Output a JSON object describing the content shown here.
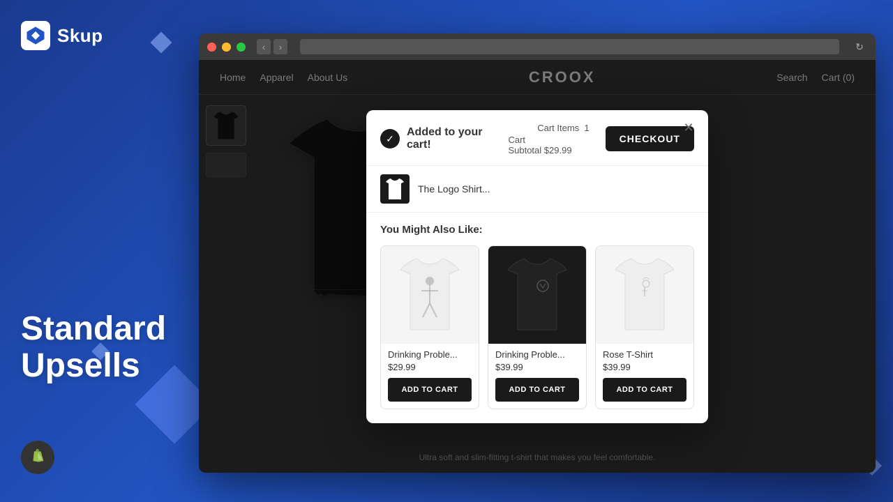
{
  "app": {
    "name": "Skup",
    "tagline": "Standard\nUpsells"
  },
  "browser": {
    "url": ""
  },
  "website": {
    "nav": {
      "home": "Home",
      "apparel": "Apparel",
      "about": "About Us"
    },
    "logo": "CROOX",
    "actions": {
      "search": "Search",
      "cart": "Cart (0)"
    },
    "product": {
      "title": "The Logo Shirt...",
      "footer_text": "Ultra soft and slim-fitting t-shirt that makes you feel comfortable."
    }
  },
  "modal": {
    "added_text": "Added to your cart!",
    "cart_items_label": "Cart Items",
    "cart_items_count": "1",
    "cart_subtotal_label": "Cart Subtotal",
    "cart_subtotal_value": "$29.99",
    "checkout_label": "CHECKOUT",
    "product_name": "The Logo Shirt...",
    "upsells_title": "You Might Also Like:",
    "upsell_products": [
      {
        "name": "Drinking Proble...",
        "price": "$29.99",
        "theme": "light",
        "button_label": "ADD TO CART"
      },
      {
        "name": "Drinking Proble...",
        "price": "$39.99",
        "theme": "dark",
        "button_label": "ADD TO CART"
      },
      {
        "name": "Rose T-Shirt",
        "price": "$39.99",
        "theme": "light",
        "button_label": "ADD TO CART"
      }
    ]
  }
}
